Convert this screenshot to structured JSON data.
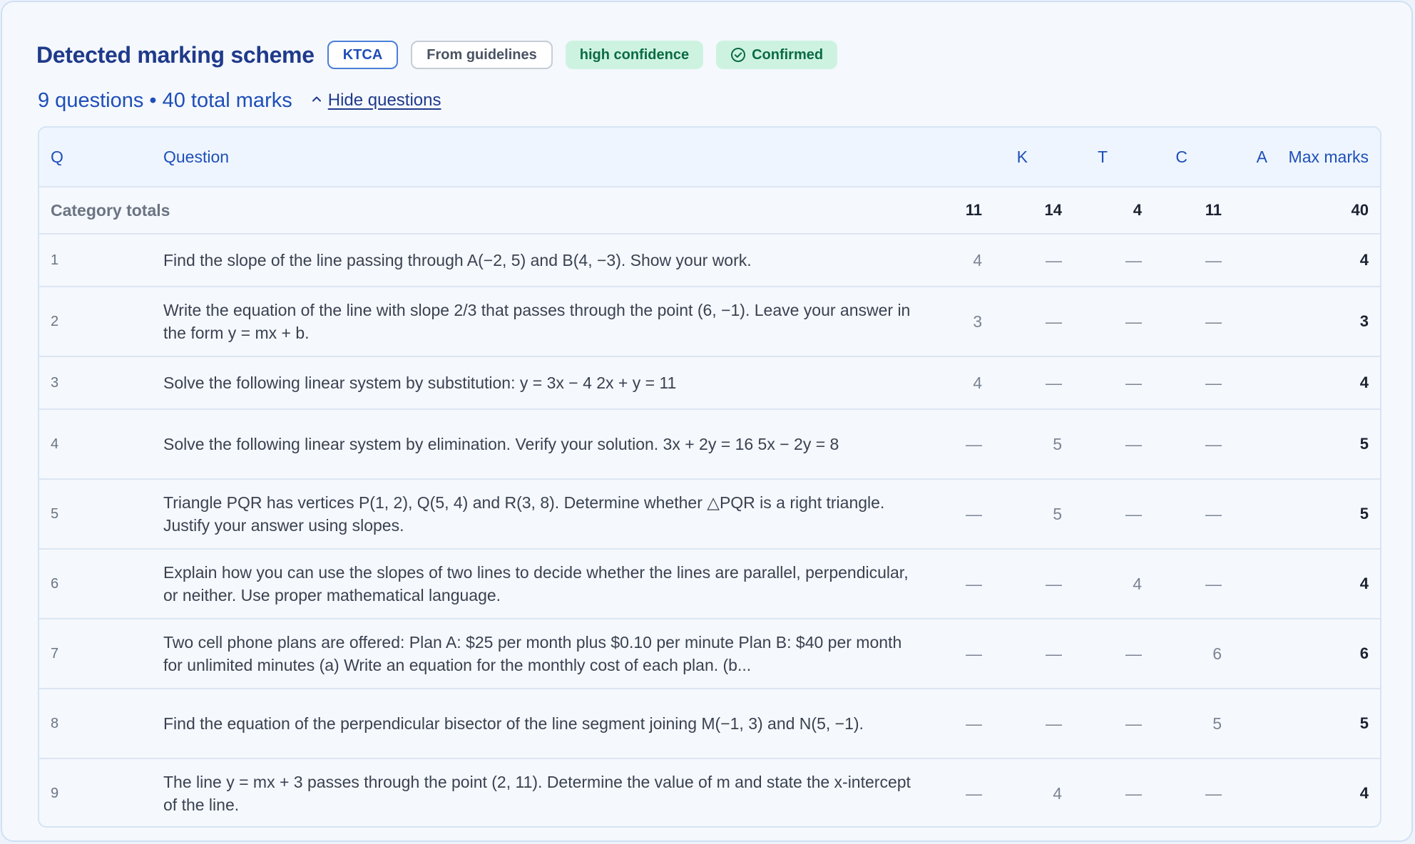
{
  "header": {
    "title": "Detected marking scheme",
    "badges": {
      "scheme": "KTCA",
      "source": "From guidelines",
      "confidence": "high confidence",
      "status": "Confirmed"
    },
    "status_icon": "check-circle-icon"
  },
  "summary": {
    "text": "9 questions • 40 total marks",
    "toggle_label": "Hide questions",
    "toggle_icon": "chevron-up-icon"
  },
  "table": {
    "columns": {
      "q": "Q",
      "question": "Question",
      "k": "K",
      "t": "T",
      "c": "C",
      "a": "A",
      "max": "Max marks"
    },
    "totals": {
      "label": "Category totals",
      "k": "11",
      "t": "14",
      "c": "4",
      "a": "11",
      "max": "40"
    },
    "rows": [
      {
        "q": "1",
        "question": "Find the slope of the line passing through A(−2, 5) and B(4, −3). Show your work.",
        "k": "4",
        "t": "—",
        "c": "—",
        "a": "—",
        "max": "4"
      },
      {
        "q": "2",
        "question": "Write the equation of the line with slope 2/3 that passes through the point (6, −1). Leave your answer in the form y = mx + b.",
        "k": "3",
        "t": "—",
        "c": "—",
        "a": "—",
        "max": "3"
      },
      {
        "q": "3",
        "question": "Solve the following linear system by substitution: y = 3x − 4 2x + y = 11",
        "k": "4",
        "t": "—",
        "c": "—",
        "a": "—",
        "max": "4"
      },
      {
        "q": "4",
        "question": "Solve the following linear system by elimination. Verify your solution. 3x + 2y = 16 5x − 2y = 8",
        "k": "—",
        "t": "5",
        "c": "—",
        "a": "—",
        "max": "5"
      },
      {
        "q": "5",
        "question": "Triangle PQR has vertices P(1, 2), Q(5, 4) and R(3, 8). Determine whether △PQR is a right triangle. Justify your answer using slopes.",
        "k": "—",
        "t": "5",
        "c": "—",
        "a": "—",
        "max": "5"
      },
      {
        "q": "6",
        "question": "Explain how you can use the slopes of two lines to decide whether the lines are parallel, perpendicular, or neither. Use proper mathematical language.",
        "k": "—",
        "t": "—",
        "c": "4",
        "a": "—",
        "max": "4"
      },
      {
        "q": "7",
        "question": "Two cell phone plans are offered: Plan A: $25 per month plus $0.10 per minute Plan B: $40 per month for unlimited minutes (a) Write an equation for the monthly cost of each plan. (b...",
        "k": "—",
        "t": "—",
        "c": "—",
        "a": "6",
        "max": "6"
      },
      {
        "q": "8",
        "question": "Find the equation of the perpendicular bisector of the line segment joining M(−1, 3) and N(5, −1).",
        "k": "—",
        "t": "—",
        "c": "—",
        "a": "5",
        "max": "5"
      },
      {
        "q": "9",
        "question": "The line y = mx + 3 passes through the point (2, 11). Determine the value of m and state the x-intercept of the line.",
        "k": "—",
        "t": "4",
        "c": "—",
        "a": "—",
        "max": "4"
      }
    ]
  }
}
